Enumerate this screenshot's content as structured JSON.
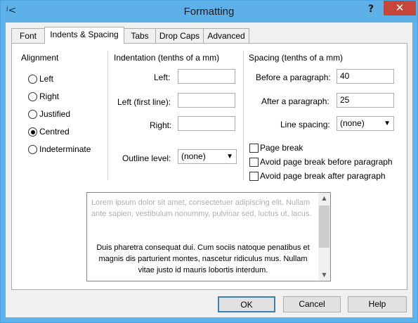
{
  "window": {
    "title": "Formatting",
    "help_label": "?",
    "close_label": "✕",
    "app_icon": "ʲ<"
  },
  "tabs": [
    {
      "label": "Font",
      "active": false
    },
    {
      "label": "Indents & Spacing",
      "active": true
    },
    {
      "label": "Tabs",
      "active": false
    },
    {
      "label": "Drop Caps",
      "active": false
    },
    {
      "label": "Advanced",
      "active": false
    }
  ],
  "alignment": {
    "heading": "Alignment",
    "options": [
      {
        "label": "Left",
        "checked": false
      },
      {
        "label": "Right",
        "checked": false
      },
      {
        "label": "Justified",
        "checked": false
      },
      {
        "label": "Centred",
        "checked": true
      },
      {
        "label": "Indeterminate",
        "checked": false
      }
    ]
  },
  "indentation": {
    "heading": "Indentation (tenths of a mm)",
    "left_label": "Left:",
    "left_value": "",
    "first_line_label": "Left (first line):",
    "first_line_value": "",
    "right_label": "Right:",
    "right_value": "",
    "outline_label": "Outline level:",
    "outline_value": "(none)"
  },
  "spacing": {
    "heading": "Spacing (tenths of a mm)",
    "before_label": "Before a paragraph:",
    "before_value": "40",
    "after_label": "After a paragraph:",
    "after_value": "25",
    "line_spacing_label": "Line spacing:",
    "line_spacing_value": "(none)"
  },
  "checkboxes": [
    {
      "label": "Page break",
      "checked": false
    },
    {
      "label": "Avoid page break before paragraph",
      "checked": false
    },
    {
      "label": "Avoid page break after paragraph",
      "checked": false
    }
  ],
  "preview": {
    "grey_text": "Lorem ipsum dolor sit amet, consectetuer adipiscing elit. Nullam ante sapien, vestibulum nonummy, pulvinar sed, luctus ut, lacus.",
    "sample_text": "Duis pharetra consequat dui. Cum sociis natoque penatibus et magnis dis parturient montes, nascetur ridiculus mus. Nullam vitae justo id mauris lobortis interdum."
  },
  "buttons": {
    "ok": "OK",
    "cancel": "Cancel",
    "help": "Help"
  }
}
